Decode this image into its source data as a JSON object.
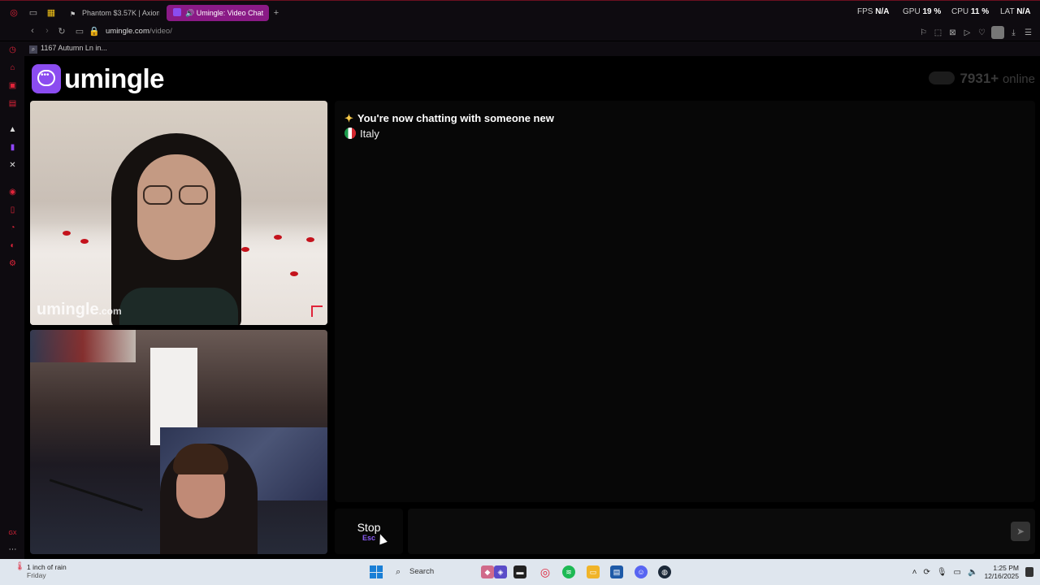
{
  "browser": {
    "tabs": [
      {
        "label": "Phantom $3.57K | Axiom",
        "active": false
      },
      {
        "label": "Umingle: Video Chat",
        "active": true
      }
    ],
    "stats": {
      "fps_label": "FPS",
      "fps_value": "N/A",
      "gpu_label": "GPU",
      "gpu_value": "19 %",
      "cpu_label": "CPU",
      "cpu_value": "11 %",
      "lat_label": "LAT",
      "lat_value": "N/A"
    },
    "url_host": "umingle.com",
    "url_path": "/video/",
    "bookmark": "1167 Autumn Ln in..."
  },
  "page": {
    "logo_text": "umingle",
    "online_count": "7931+",
    "online_label": "online",
    "watermark": "umingle",
    "watermark_suffix": ".com",
    "chat_message": "You're now chatting with someone new",
    "country": "Italy",
    "stop_label": "Stop",
    "stop_key": "Esc"
  },
  "taskbar": {
    "weather_line1": "1 inch of rain",
    "weather_line2": "Friday",
    "search_label": "Search",
    "time": "1:25 PM",
    "date": "12/16/2025"
  },
  "colors": {
    "accent_purple": "#8b4cf0",
    "opera_red": "#e0243a",
    "active_tab": "#8a1a86"
  }
}
